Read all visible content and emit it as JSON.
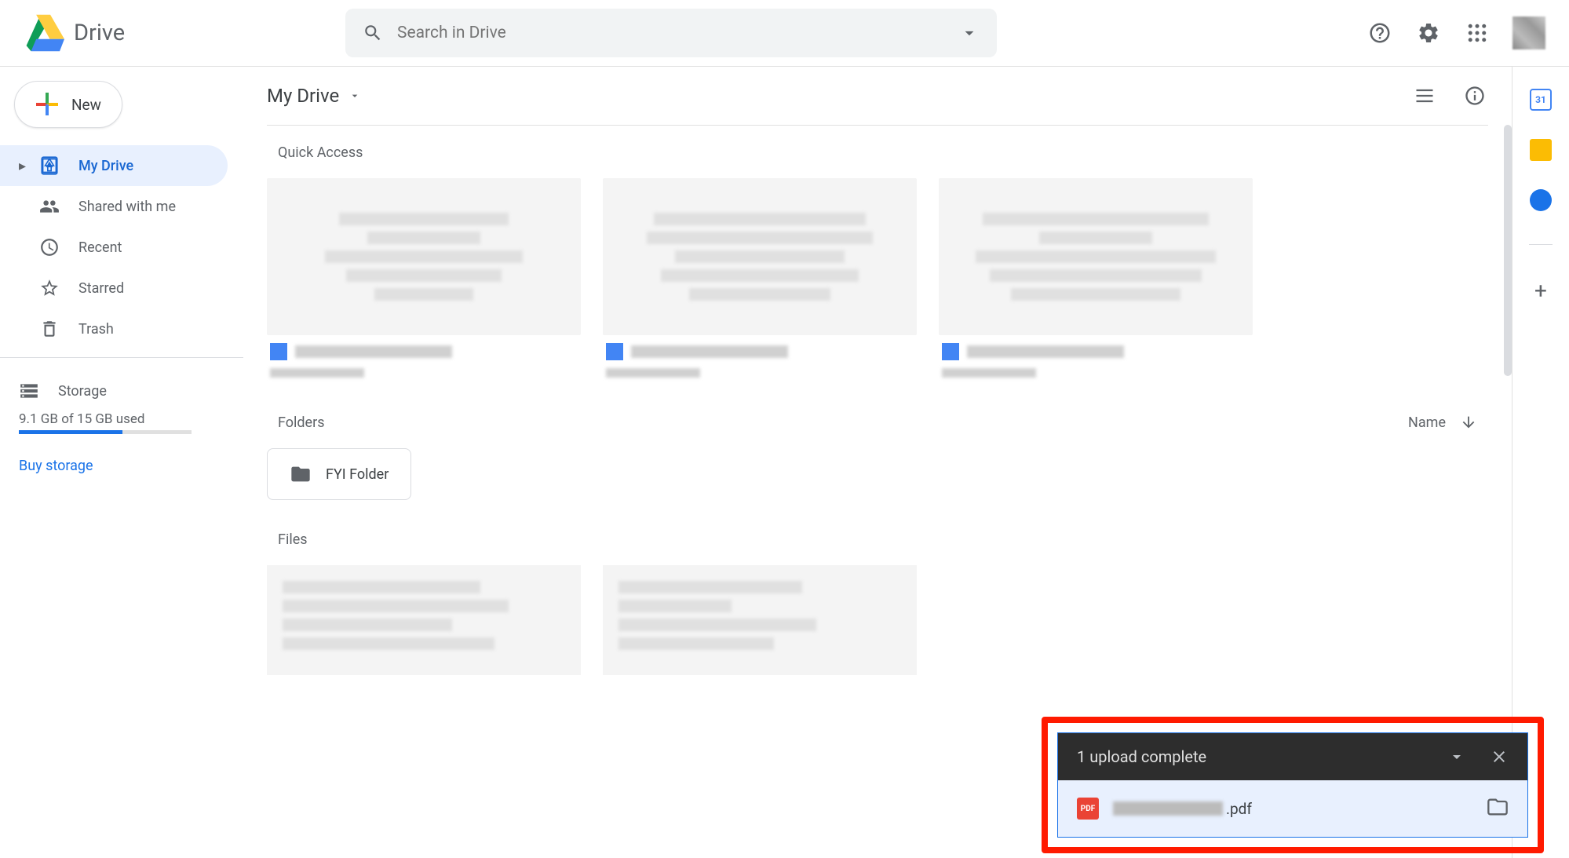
{
  "app_name": "Drive",
  "search": {
    "placeholder": "Search in Drive"
  },
  "new_button": "New",
  "nav": {
    "my_drive": "My Drive",
    "shared": "Shared with me",
    "recent": "Recent",
    "starred": "Starred",
    "trash": "Trash",
    "storage": "Storage"
  },
  "storage": {
    "used_text": "9.1 GB of 15 GB used",
    "percent": 60,
    "buy": "Buy storage"
  },
  "breadcrumb": "My Drive",
  "sections": {
    "quick_access": "Quick Access",
    "folders": "Folders",
    "files": "Files"
  },
  "sort": {
    "label": "Name"
  },
  "folders": [
    {
      "name": "FYI Folder"
    }
  ],
  "upload_toast": {
    "title": "1 upload complete",
    "file_suffix": ".pdf"
  },
  "rail": {
    "calendar_day": "31"
  }
}
